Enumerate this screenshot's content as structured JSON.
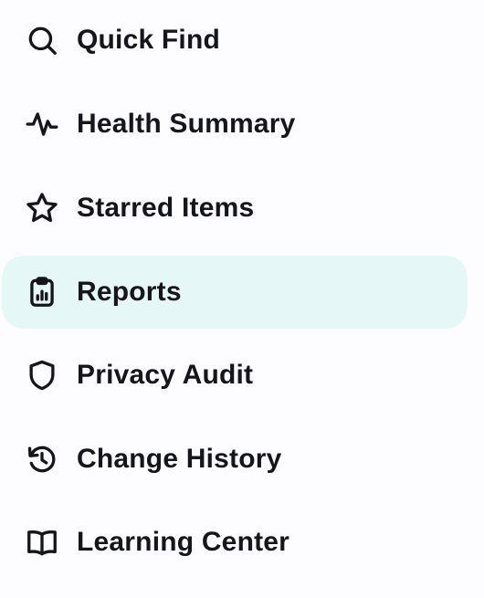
{
  "nav": {
    "items": [
      {
        "label": "Quick Find",
        "icon": "search-icon",
        "active": false
      },
      {
        "label": "Health Summary",
        "icon": "activity-icon",
        "active": false
      },
      {
        "label": "Starred Items",
        "icon": "star-icon",
        "active": false
      },
      {
        "label": "Reports",
        "icon": "clipboard-chart-icon",
        "active": true
      },
      {
        "label": "Privacy Audit",
        "icon": "shield-icon",
        "active": false
      },
      {
        "label": "Change History",
        "icon": "history-icon",
        "active": false
      },
      {
        "label": "Learning Center",
        "icon": "book-open-icon",
        "active": false
      }
    ]
  },
  "colors": {
    "background": "#FDFCFF",
    "text": "#15161B",
    "active_background": "#E6F7F7"
  }
}
